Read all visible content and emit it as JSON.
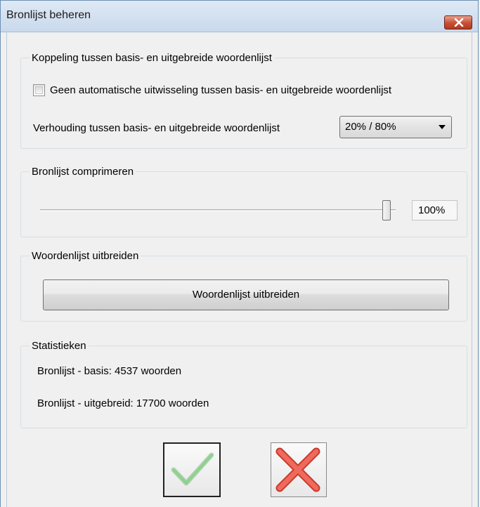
{
  "window": {
    "title": "Bronlijst beheren"
  },
  "koppeling": {
    "legend": "Koppeling tussen basis- en uitgebreide woordenlijst",
    "checkbox_label": "Geen automatische uitwisseling tussen basis- en uitgebreide woordenlijst",
    "checkbox_checked": false,
    "ratio_label": "Verhouding tussen basis- en uitgebreide woordenlijst",
    "ratio_value": "20% / 80%"
  },
  "comprimeren": {
    "legend": "Bronlijst comprimeren",
    "slider_percent": 100,
    "value_text": "100%"
  },
  "uitbreiden": {
    "legend": "Woordenlijst uitbreiden",
    "button_label": "Woordenlijst uitbreiden"
  },
  "statistieken": {
    "legend": "Statistieken",
    "basis": "Bronlijst - basis: 4537 woorden",
    "uitgebreid": "Bronlijst - uitgebreid: 17700 woorden"
  },
  "icons": {
    "close": "close-icon",
    "ok": "checkmark-icon",
    "cancel": "cross-icon"
  },
  "colors": {
    "checkmark": "#5cb85c",
    "cross": "#e84a3c",
    "close_button": "#c64f35"
  }
}
